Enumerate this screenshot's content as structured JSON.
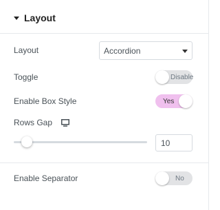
{
  "section": {
    "title": "Layout",
    "caret_icon": "caret-down-icon"
  },
  "controls": {
    "layout": {
      "label": "Layout",
      "selected": "Accordion"
    },
    "toggle": {
      "label": "Toggle",
      "state_text": "Disable",
      "checked": false
    },
    "box_style": {
      "label": "Enable Box Style",
      "state_text": "Yes",
      "checked": true
    },
    "rows_gap": {
      "label": "Rows Gap",
      "device_icon": "desktop-monitor-icon",
      "value": "10",
      "slider_fraction": 0.1
    },
    "separator": {
      "label": "Enable Separator",
      "state_text": "No",
      "checked": false
    }
  },
  "colors": {
    "switch_on": "#f0c0ee",
    "switch_off": "#e2e3e5",
    "label_text": "#495157"
  }
}
